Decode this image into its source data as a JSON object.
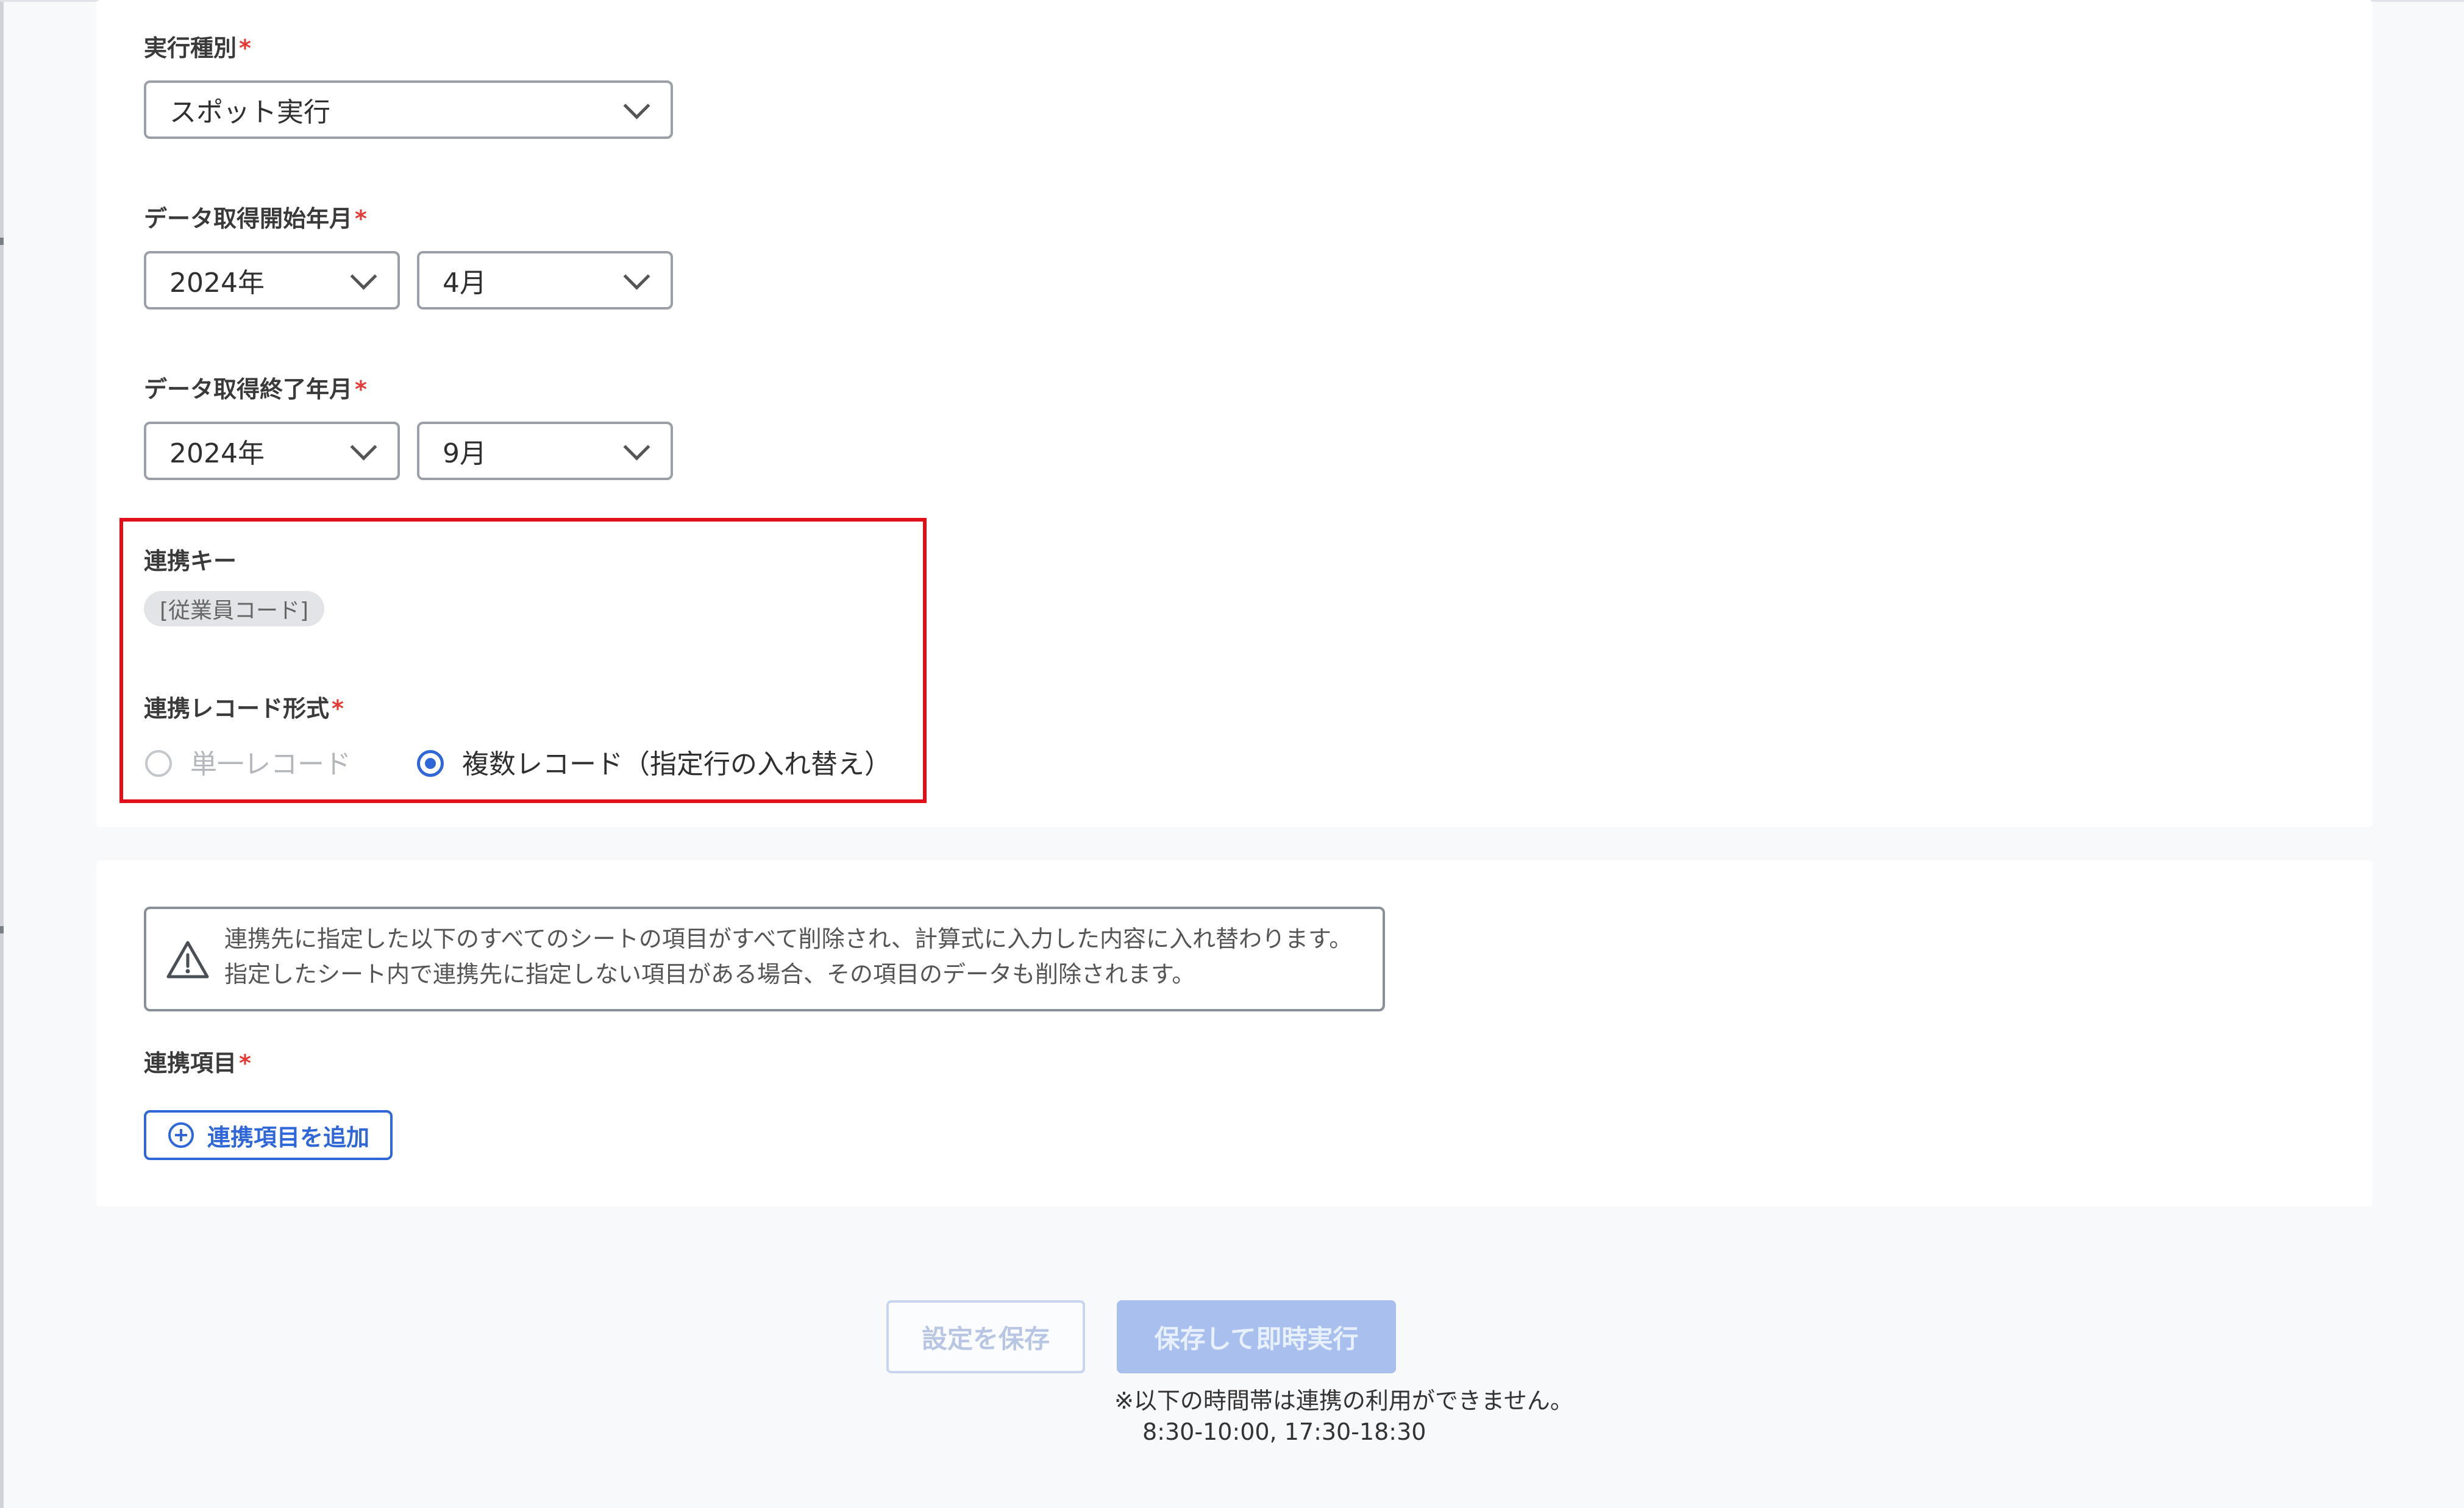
{
  "execution_type": {
    "label": "実行種別",
    "required_mark": "*",
    "value": "スポット実行"
  },
  "data_start": {
    "label": "データ取得開始年月",
    "required_mark": "*",
    "year": "2024年",
    "month": "4月"
  },
  "data_end": {
    "label": "データ取得終了年月",
    "required_mark": "*",
    "year": "2024年",
    "month": "9月"
  },
  "link_key": {
    "label": "連携キー",
    "chip": "[従業員コード]"
  },
  "record_format": {
    "label": "連携レコード形式",
    "required_mark": "*",
    "options": [
      {
        "label": "単一レコード",
        "selected": false,
        "disabled": true
      },
      {
        "label": "複数レコード（指定行の入れ替え）",
        "selected": true,
        "disabled": false
      }
    ]
  },
  "warning": {
    "icon": "warning-triangle-icon",
    "line1": "連携先に指定した以下のすべてのシートの項目がすべて削除され、計算式に入力した内容に入れ替わります。",
    "line2": "指定したシート内で連携先に指定しない項目がある場合、その項目のデータも削除されます。"
  },
  "link_items": {
    "label": "連携項目",
    "required_mark": "*",
    "add_button": "連携項目を追加"
  },
  "actions": {
    "save_label": "設定を保存",
    "save_run_label": "保存して即時実行",
    "note_line1": "※以下の時間帯は連携の利用ができません。",
    "note_line2": "8:30-10:00, 17:30-18:30"
  },
  "colors": {
    "accent": "#2f67d8",
    "highlight": "#e0101a",
    "required": "#e53935"
  }
}
